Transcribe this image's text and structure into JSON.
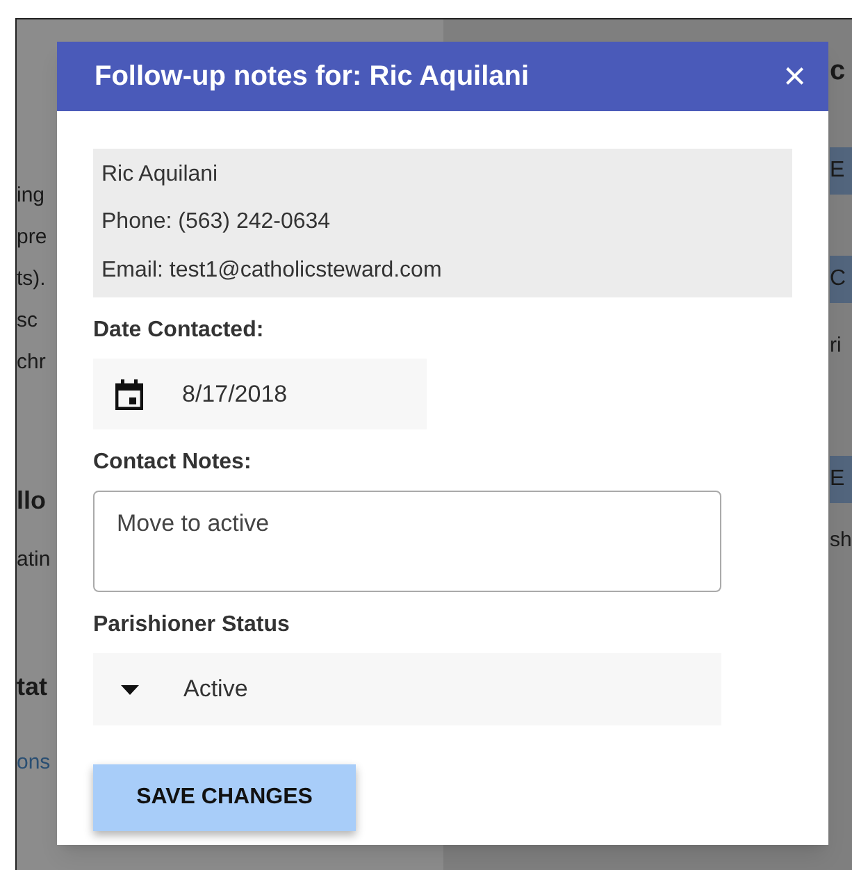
{
  "background": {
    "left_fragments": [
      {
        "text": "ing",
        "kind": "text"
      },
      {
        "text": "pre",
        "kind": "text"
      },
      {
        "text": "ts).",
        "kind": "text"
      },
      {
        "text": "sc",
        "kind": "text"
      },
      {
        "text": "chr",
        "kind": "text"
      },
      {
        "text": "llo",
        "kind": "heading"
      },
      {
        "text": "atin",
        "kind": "text"
      },
      {
        "text": "tat",
        "kind": "heading"
      },
      {
        "text": "ons",
        "kind": "link"
      }
    ],
    "right_fragments": [
      {
        "text": "c",
        "kind": "heading"
      },
      {
        "text": "E",
        "kind": "bar"
      },
      {
        "text": "C",
        "kind": "bar"
      },
      {
        "text": "ri",
        "kind": "text"
      },
      {
        "text": "E",
        "kind": "bar"
      },
      {
        "text": "sh",
        "kind": "text"
      }
    ]
  },
  "dialog": {
    "title": "Follow-up notes for: Ric Aquilani",
    "close": "×",
    "info": [
      "Ric Aquilani",
      "Phone: (563) 242-0634",
      "Email: test1@catholicsteward.com"
    ],
    "date_label": "Date Contacted:",
    "date_value": "8/17/2018",
    "notes_label": "Contact Notes:",
    "notes_value": "Move to active",
    "status_label": "Parishioner Status",
    "status_value": "Active",
    "save_button": "SAVE CHANGES"
  }
}
